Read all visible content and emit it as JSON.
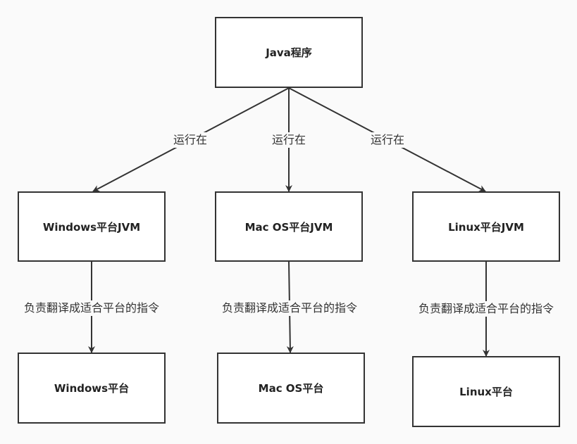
{
  "diagram": {
    "nodes": {
      "java_program": "Java程序",
      "windows_jvm": "Windows平台JVM",
      "mac_jvm": "Mac OS平台JVM",
      "linux_jvm": "Linux平台JVM",
      "windows_platform": "Windows平台",
      "mac_platform": "Mac OS平台",
      "linux_platform": "Linux平台"
    },
    "edges": {
      "java_to_windows": "运行在",
      "java_to_mac": "运行在",
      "java_to_linux": "运行在",
      "windows_jvm_to_platform": "负责翻译成适合平台的指令",
      "mac_jvm_to_platform": "负责翻译成适合平台的指令",
      "linux_jvm_to_platform": "负责翻译成适合平台的指令"
    },
    "colors": {
      "stroke": "#333333",
      "node_fill": "#ffffff",
      "background": "#fafafa"
    }
  }
}
